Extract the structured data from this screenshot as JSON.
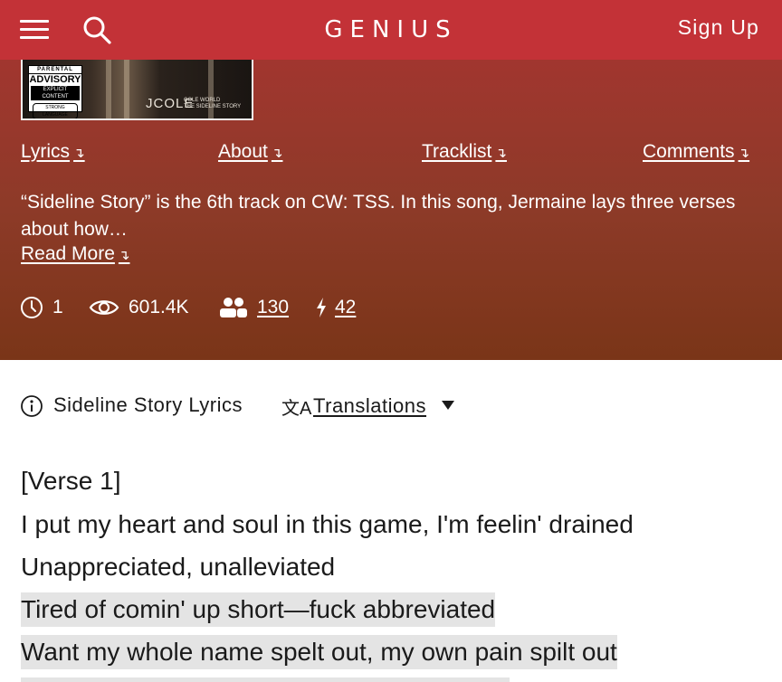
{
  "nav": {
    "logo": "GENIUS",
    "signup_label": "Sign Up",
    "menu_icon": "hamburger-menu-icon",
    "search_icon": "search-icon"
  },
  "album_art": {
    "parental_advisory": {
      "line1": "PARENTAL",
      "line2": "ADVISORY",
      "line3": "EXPLICIT CONTENT",
      "line4": "STRONG LANGUAGE"
    },
    "cover_text": "JCOLE",
    "cover_subtext_1": "COLE WORLD",
    "cover_subtext_2": "THE SIDELINE STORY"
  },
  "subnav": {
    "items": [
      {
        "label": "Lyrics"
      },
      {
        "label": "About"
      },
      {
        "label": "Tracklist"
      },
      {
        "label": "Comments"
      }
    ],
    "arrow": "↴"
  },
  "description": {
    "text": "“Sideline Story” is the 6th track on CW: TSS. In this song, Jermaine lays three verses about how…",
    "read_more": "Read More"
  },
  "stats": {
    "contributors": "1",
    "views": "601.4K",
    "followers": "130",
    "annotations": "42"
  },
  "lyrics_header": {
    "title": "Sideline Story Lyrics",
    "translations_label": "Translations",
    "translate_glyph": "文A"
  },
  "lyrics": {
    "lines": [
      {
        "text": "[Verse 1]",
        "highlighted": false
      },
      {
        "text": "I put my heart and soul in this game, I'm feelin' drained",
        "highlighted": false
      },
      {
        "text": "Unappreciated, unalleviated",
        "highlighted": false
      },
      {
        "text": "Tired of comin' up short—fuck abbreviated",
        "highlighted": true
      },
      {
        "text": "Want my whole name spelt out, my own pain spilt out",
        "highlighted": true
      }
    ]
  },
  "colors": {
    "brand_red": "#c33237",
    "header_gradient_top": "#a1362f",
    "header_gradient_bottom": "#7a3518",
    "highlight": "#e4e4e4"
  }
}
